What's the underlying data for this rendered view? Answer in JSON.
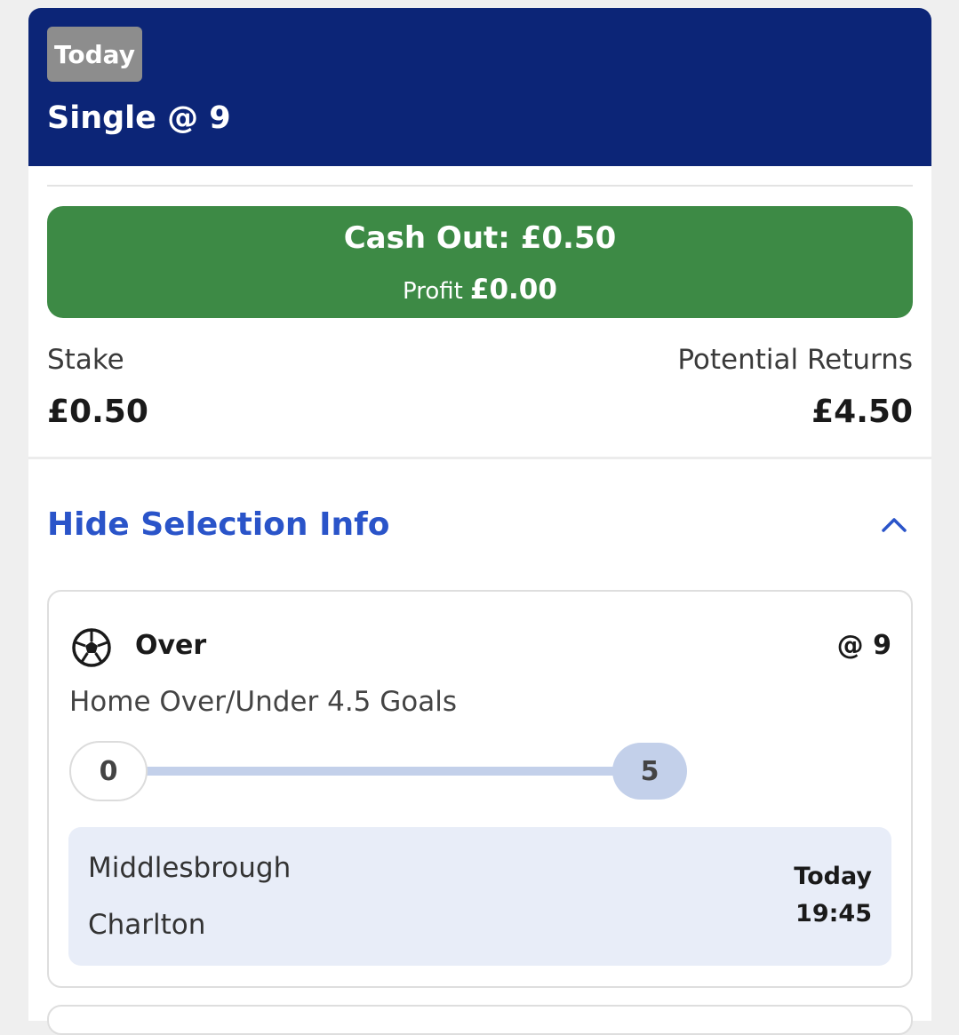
{
  "bet": {
    "badge": "Today",
    "title": "Single @ 9"
  },
  "cashout": {
    "label": "Cash Out: £0.50",
    "profit_label": "Profit",
    "profit_value": "£0.00"
  },
  "summary": {
    "stake_label": "Stake",
    "stake_value": "£0.50",
    "returns_label": "Potential Returns",
    "returns_value": "£4.50"
  },
  "selection_toggle": {
    "label": "Hide Selection Info",
    "icon": "chevron-up-icon"
  },
  "selection": {
    "sport_icon": "football-icon",
    "name": "Over",
    "odds": "@ 9",
    "market": "Home Over/Under 4.5 Goals",
    "progress": {
      "start": "0",
      "end": "5",
      "current": 0
    },
    "event": {
      "home": "Middlesbrough",
      "away": "Charlton",
      "day": "Today",
      "time": "19:45"
    }
  },
  "colors": {
    "header": "#0c2577",
    "cashout": "#3d8a45",
    "link": "#2a54c9",
    "badge": "#8d8d8d",
    "track": "#c3d0ea",
    "event_bg": "#e8edf8"
  }
}
